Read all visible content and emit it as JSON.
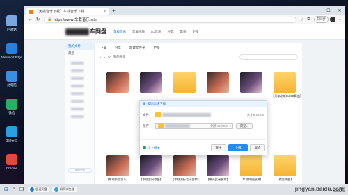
{
  "desktop": {
    "icons": [
      {
        "label": "回收站",
        "color": "#7aa7e0"
      },
      {
        "label": "Microsoft Edge",
        "color": "#2a7fd6"
      },
      {
        "label": "此电脑",
        "color": "#3b8fe0"
      },
      {
        "label": "微信",
        "color": "#2aae67"
      },
      {
        "label": "360安全",
        "color": "#2aa0e0"
      },
      {
        "label": "Chrome",
        "color": "#e04a3b"
      }
    ]
  },
  "browser": {
    "tab_title": "【无损音乐下载】车载音乐下载",
    "tab_close": "×",
    "new_tab": "+",
    "window_controls": {
      "minimize": "—",
      "maximize": "☐",
      "close": "✕"
    },
    "url": "https://www.车载音乐.site",
    "profile_label": "未同步"
  },
  "site": {
    "logo_text": "车网盘",
    "nav": [
      "车载音乐",
      "车载视频",
      "DJ音乐",
      "经典",
      "影视",
      "更多"
    ],
    "nav_active_index": 0,
    "sidebar": {
      "items": [
        "我的文件",
        "最近"
      ],
      "quota": "剩余空间"
    },
    "toolbar": [
      "下载",
      "分享",
      "新建文件夹",
      "更多"
    ],
    "breadcrumb": [
      "我的网盘"
    ],
    "files_row1": [
      {
        "name": "",
        "kind": "photo"
      },
      {
        "name": "",
        "kind": "photo2"
      },
      {
        "name": "",
        "kind": "folder"
      },
      {
        "name": "",
        "kind": "photo"
      },
      {
        "name": "",
        "kind": "photo2"
      },
      {
        "name": "【开车必听DJ 3D舞曲】",
        "kind": "folder"
      }
    ],
    "files_row2": [
      {
        "name": "【车载抖音音乐】",
        "kind": "photo"
      },
      {
        "name": "【车载古风歌曲】",
        "kind": "photo2"
      },
      {
        "name": "【车载流行音乐合辑】",
        "kind": "photo"
      },
      {
        "name": "【最火民谣合辑】",
        "kind": "photo2"
      },
      {
        "name": "【车载怀旧经典】",
        "kind": "folder"
      },
      {
        "name": "【夜店嗨曲】",
        "kind": "folder"
      }
    ]
  },
  "dialog": {
    "title": "极速高速下载",
    "filename_label": "文件",
    "size": "大小2.60GB",
    "path_label": "保存",
    "disk_free": "剩余46.7GB",
    "browse": "浏览...",
    "footer_link": "仅下载",
    "btn_unzip": "解压",
    "btn_download": "下载",
    "btn_cancel": "取消"
  },
  "taskbar": {
    "apps": [
      "极速网盘",
      "网页浏览器"
    ],
    "time": "19:09",
    "date": "2022/02/18"
  },
  "watermark": "jingyan.baidu.com"
}
